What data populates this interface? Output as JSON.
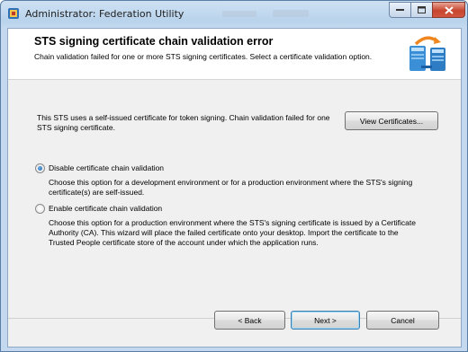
{
  "window": {
    "title": "Administrator: Federation Utility",
    "controls": {
      "minimize_icon": "minimize-icon",
      "maximize_icon": "maximize-icon",
      "close_icon": "close-icon"
    }
  },
  "header": {
    "title": "STS signing certificate chain validation error",
    "subtitle": "Chain validation failed for one or more STS signing certificates. Select a certificate validation option."
  },
  "info": {
    "line1": "This STS uses a self-issued certificate for token signing. Chain validation failed for one",
    "line2": "STS signing certificate.",
    "view_button": "View Certificates..."
  },
  "options": [
    {
      "label": "Disable certificate chain validation",
      "selected": true,
      "desc_lines": [
        "Choose this option for a development environment or for a production environment where the STS's signing",
        "certificate(s) are self-issued."
      ]
    },
    {
      "label": "Enable certificate chain validation",
      "selected": false,
      "desc_lines": [
        "Choose this option for a production environment where the STS's signing certificate is issued by a Certificate",
        "Authority (CA).  This wizard will place the failed certificate onto your desktop. Import the certificate to the",
        "Trusted People certificate store of the account under which the application runs."
      ]
    }
  ],
  "footer": {
    "back": "< Back",
    "next": "Next >",
    "cancel": "Cancel"
  },
  "colors": {
    "titlebar": "#c4d9ef",
    "client_bg": "#f0f0f0",
    "header_bg": "#ffffff",
    "close_red": "#c7452f"
  }
}
